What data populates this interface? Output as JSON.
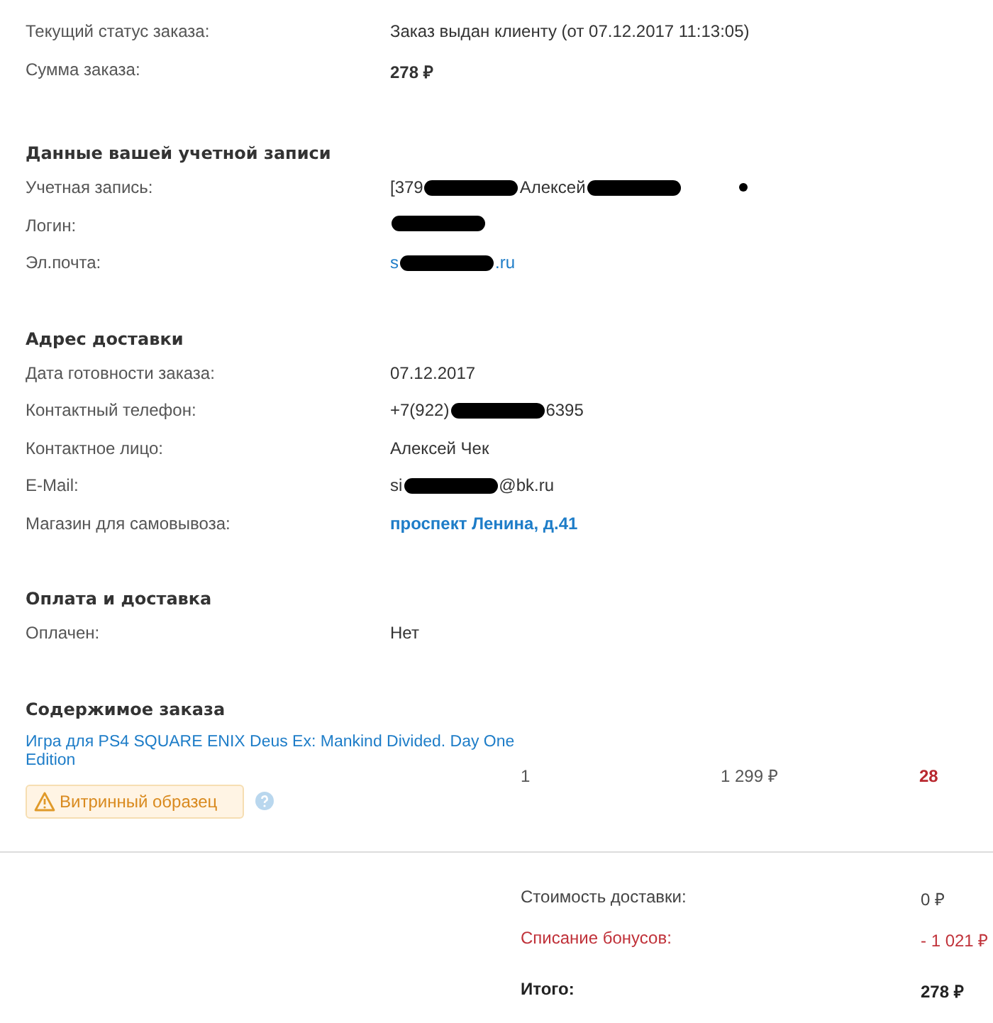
{
  "summary": [
    {
      "label": "Текущий статус заказа:",
      "value": [
        {
          "kind": "text",
          "text": "Заказ выдан клиенту (от 07.12.2017 11:13:05)"
        }
      ],
      "kind": "plain"
    },
    {
      "label": "Сумма заказа:",
      "value": [
        {
          "kind": "text",
          "text": "278 ₽"
        }
      ],
      "kind": "bold"
    }
  ],
  "sections": [
    {
      "title": "Данные вашей учетной записи",
      "rows": [
        {
          "label": "Учетная запись:",
          "kind": "plain",
          "value": [
            {
              "kind": "text",
              "text": "[379"
            },
            {
              "kind": "redaction"
            },
            {
              "kind": "text",
              "text": "Алексей"
            },
            {
              "kind": "redaction"
            },
            {
              "kind": "dot"
            }
          ]
        },
        {
          "label": "Логин:",
          "value": [
            {
              "kind": "redaction"
            }
          ]
        },
        {
          "label": "Эл.почта:",
          "kind": "link",
          "value": [
            {
              "kind": "text",
              "text": "s"
            },
            {
              "kind": "redaction"
            },
            {
              "kind": "text",
              "text": ".ru"
            }
          ]
        }
      ]
    },
    {
      "title": "Адрес доставки",
      "rows": [
        {
          "label": "Дата готовности заказа:",
          "kind": "plain",
          "value": [
            {
              "kind": "text",
              "text": "07.12.2017"
            }
          ]
        },
        {
          "label": "Контактный телефон:",
          "kind": "plain",
          "value": [
            {
              "kind": "text",
              "text": "+7(922)"
            },
            {
              "kind": "redaction"
            },
            {
              "kind": "text",
              "text": "6395"
            }
          ]
        },
        {
          "label": "Контактное лицо:",
          "kind": "plain",
          "value": [
            {
              "kind": "text",
              "text": "Алексей Чек"
            }
          ]
        },
        {
          "label": "E-Mail:",
          "kind": "plain",
          "value": [
            {
              "kind": "text",
              "text": "si"
            },
            {
              "kind": "redaction"
            },
            {
              "kind": "text",
              "text": "@bk.ru"
            }
          ]
        },
        {
          "label": "Магазин для самовывоза:",
          "kind": "boldlink",
          "value": [
            {
              "kind": "text",
              "text": "проспект Ленина, д.41"
            }
          ]
        }
      ]
    },
    {
      "title": "Оплата и доставка",
      "rows": [
        {
          "label": "Оплачен:",
          "kind": "plain",
          "value": [
            {
              "kind": "text",
              "text": "Нет"
            }
          ]
        }
      ]
    }
  ],
  "contents": {
    "title": "Содержимое заказа",
    "items": [
      {
        "name": "Игра для PS4 SQUARE ENIX Deus Ex: Mankind Divided. Day One Edition",
        "badge": "Витринный образец",
        "quantity": "1",
        "price": "1 299 ₽",
        "bonus": "28"
      }
    ]
  },
  "totals": [
    {
      "label": "Стоимость доставки:",
      "value": "0 ₽",
      "kind": "normal"
    },
    {
      "label": "Списание бонусов:",
      "value": "- 1 021 ₽",
      "kind": "discount"
    },
    {
      "label": "Итого:",
      "value": "278 ₽",
      "kind": "total"
    }
  ]
}
